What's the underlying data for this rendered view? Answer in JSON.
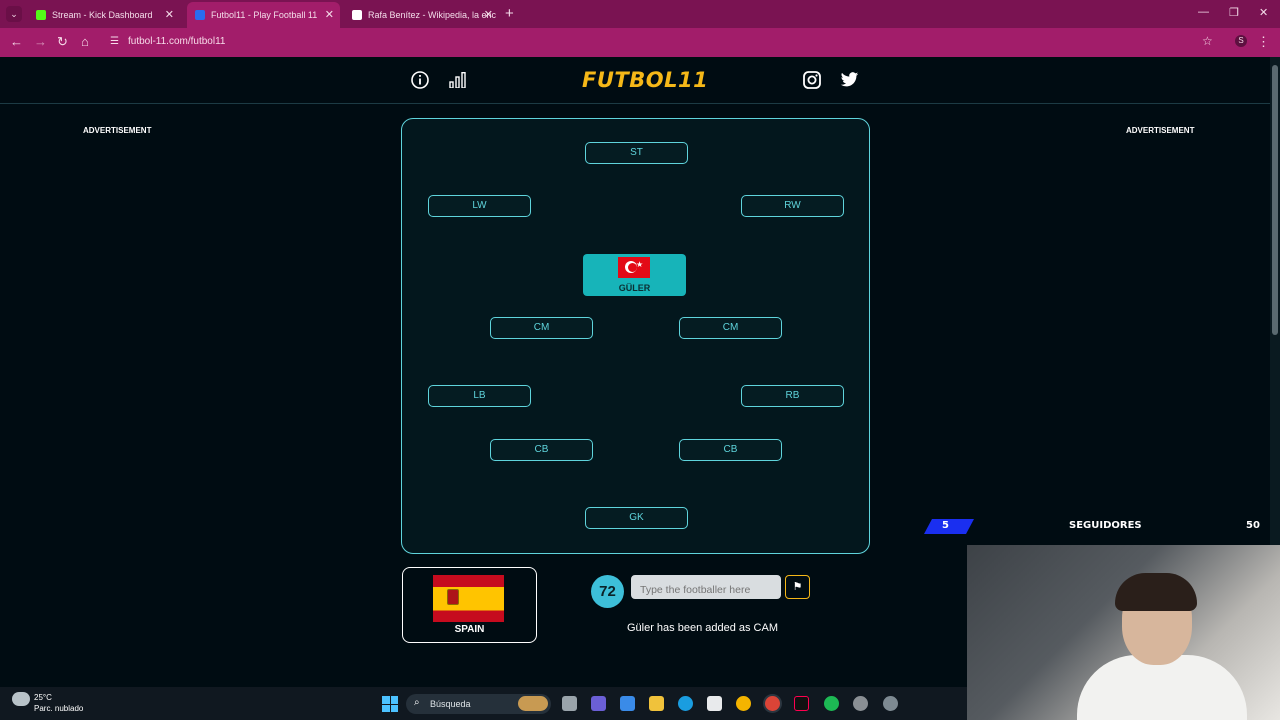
{
  "browser": {
    "tabs": [
      {
        "label": "Stream - Kick Dashboard",
        "favicon_color": "#53fc18"
      },
      {
        "label": "Futbol11 - Play Football 11",
        "favicon_color": "#2a6cf0"
      },
      {
        "label": "Rafa Benítez - Wikipedia, la enc",
        "favicon_color": "#ffffff"
      }
    ],
    "url": "futbol-11.com/futbol11",
    "profile_initial": "S"
  },
  "site": {
    "logo": "FUTBOL11",
    "advertisement_left": "ADVERTISEMENT",
    "advertisement_right": "ADVERTISEMENT"
  },
  "pitch": {
    "positions": {
      "st": "ST",
      "lw": "LW",
      "rw": "RW",
      "cm_left": "CM",
      "cm_right": "CM",
      "lb": "LB",
      "rb": "RB",
      "cb_left": "CB",
      "cb_right": "CB",
      "gk": "GK"
    },
    "cam_player": {
      "name": "GÜLER",
      "nation_flag": "turkey-flag"
    }
  },
  "nation": {
    "name": "SPAIN",
    "flag": "spain-flag"
  },
  "game": {
    "score": "72",
    "input_placeholder": "Type the footballer here",
    "message": "Güler has been added as CAM",
    "accent": "#5fd4dc",
    "logo_color": "#f5b818"
  },
  "stream_overlay": {
    "followers_current": "5",
    "followers_label": "SEGUIDORES",
    "followers_goal": "50",
    "progress_fraction": 0.1
  },
  "taskbar": {
    "temperature": "25°C",
    "weather": "Parc. nublado",
    "search_label": "Búsqueda"
  }
}
